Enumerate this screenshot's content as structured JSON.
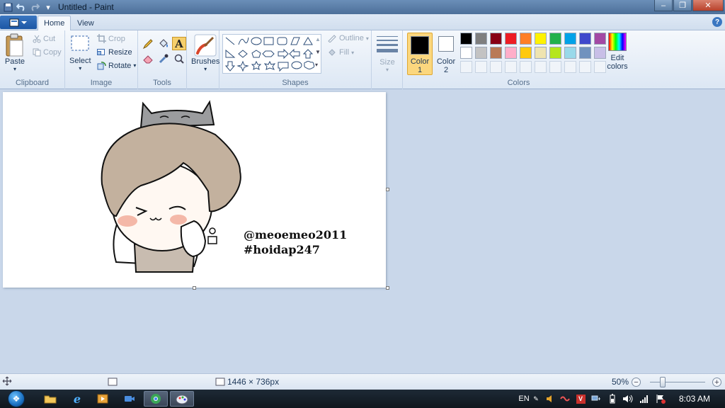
{
  "window": {
    "title": "Untitled - Paint",
    "controls": {
      "minimize": "–",
      "restore": "❐",
      "close": "✕"
    }
  },
  "quick_access": [
    {
      "icon": "save-icon"
    },
    {
      "icon": "undo-icon"
    },
    {
      "icon": "redo-icon"
    },
    {
      "icon": "customize-dropdown-icon"
    }
  ],
  "tabs": [
    {
      "label": "Home",
      "active": true
    },
    {
      "label": "View",
      "active": false
    }
  ],
  "ribbon": {
    "clipboard": {
      "group_label": "Clipboard",
      "paste": "Paste",
      "cut": "Cut",
      "copy": "Copy"
    },
    "image": {
      "group_label": "Image",
      "select": "Select",
      "crop": "Crop",
      "resize": "Resize",
      "rotate": "Rotate"
    },
    "tools": {
      "group_label": "Tools"
    },
    "brushes": {
      "label": "Brushes"
    },
    "shapes": {
      "group_label": "Shapes",
      "outline": "Outline",
      "fill": "Fill"
    },
    "size": {
      "label": "Size"
    },
    "colors": {
      "group_label": "Colors",
      "color1_label": "Color",
      "color1_num": "1",
      "color2_label": "Color",
      "color2_num": "2",
      "edit_label_1": "Edit",
      "edit_label_2": "colors",
      "color1": "#000000",
      "color2": "#ffffff",
      "palette_row1": [
        "#000000",
        "#7f7f7f",
        "#880015",
        "#ed1c24",
        "#ff7f27",
        "#fff200",
        "#22b14c",
        "#00a2e8",
        "#3f48cc",
        "#a349a4"
      ],
      "palette_row2": [
        "#ffffff",
        "#c3c3c3",
        "#b97a57",
        "#ffaec9",
        "#ffc90e",
        "#efe4b0",
        "#b5e61d",
        "#99d9ea",
        "#7092be",
        "#c8bfe7"
      ]
    }
  },
  "canvas": {
    "text_line1": "@meoemeo2011",
    "text_line2": "#hoidap247"
  },
  "status": {
    "dimensions": "1446 × 736px",
    "zoom": "50%",
    "zoom_level": 0.5
  },
  "taskbar": {
    "language": "EN",
    "time": "8:03 AM"
  }
}
